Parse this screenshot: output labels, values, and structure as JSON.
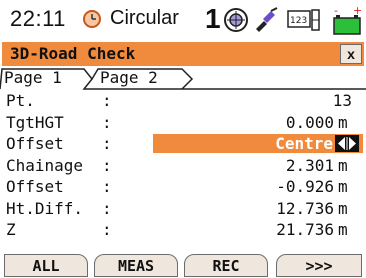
{
  "status": {
    "time": "22:11",
    "mode": "Circular",
    "face": "1",
    "icons": [
      "clock-icon",
      "prism-icon",
      "laser-icon",
      "memory-icon",
      "battery-icon"
    ],
    "accent_color": "#f08a3c"
  },
  "title": {
    "text": "3D-Road Check",
    "close_label": "x"
  },
  "tabs": [
    {
      "label": "Page 1",
      "active": true
    },
    {
      "label": "Page 2",
      "active": false
    }
  ],
  "rows": [
    {
      "label": "Pt.",
      "colon": ":",
      "value": "13",
      "unit": ""
    },
    {
      "label": "TgtHGT",
      "colon": ":",
      "value": "0.000",
      "unit": "m"
    },
    {
      "label": "Offset",
      "colon": ":",
      "value": "Centre",
      "unit": ""
    },
    {
      "label": "Chainage",
      "colon": ":",
      "value": "2.301",
      "unit": "m"
    },
    {
      "label": "Offset",
      "colon": ":",
      "value": "-0.926",
      "unit": "m"
    },
    {
      "label": "Ht.Diff.",
      "colon": ":",
      "value": "12.736",
      "unit": "m"
    },
    {
      "label": "Z",
      "colon": ":",
      "value": "21.736",
      "unit": "m"
    }
  ],
  "softkeys": [
    {
      "label": "ALL"
    },
    {
      "label": "MEAS"
    },
    {
      "label": "REC"
    },
    {
      "label": ">>>"
    }
  ]
}
